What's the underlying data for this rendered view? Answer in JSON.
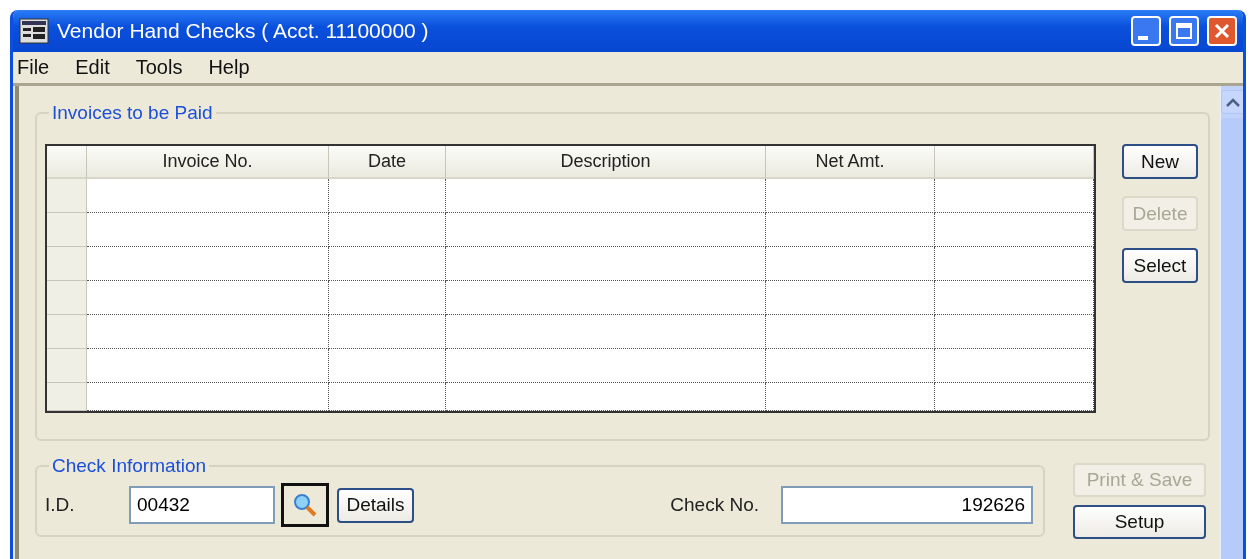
{
  "window": {
    "title": "Vendor Hand Checks ( Acct. 11100000 )"
  },
  "menu": [
    "File",
    "Edit",
    "Tools",
    "Help"
  ],
  "invoices": {
    "title": "Invoices to be Paid",
    "columns": [
      "Invoice No.",
      "Date",
      "Description",
      "Net Amt."
    ],
    "rows": [
      {
        "kind": "empty"
      },
      {
        "kind": "empty"
      },
      {
        "kind": "empty"
      },
      {
        "kind": "empty"
      },
      {
        "kind": "empty"
      },
      {
        "kind": "empty"
      },
      {
        "kind": "partial"
      }
    ],
    "buttons": [
      {
        "label": "New",
        "disabled": false
      },
      {
        "label": "Delete",
        "disabled": true
      },
      {
        "label": "Select",
        "disabled": false
      }
    ]
  },
  "check_info": {
    "title": "Check Information",
    "id_label": "I.D.",
    "id_value": "00432",
    "details_button": "Details",
    "check_no_label": "Check No.",
    "check_no_value": "192626"
  },
  "side_buttons": [
    {
      "label": "Print & Save",
      "disabled": true
    },
    {
      "label": "Setup",
      "disabled": false
    }
  ]
}
